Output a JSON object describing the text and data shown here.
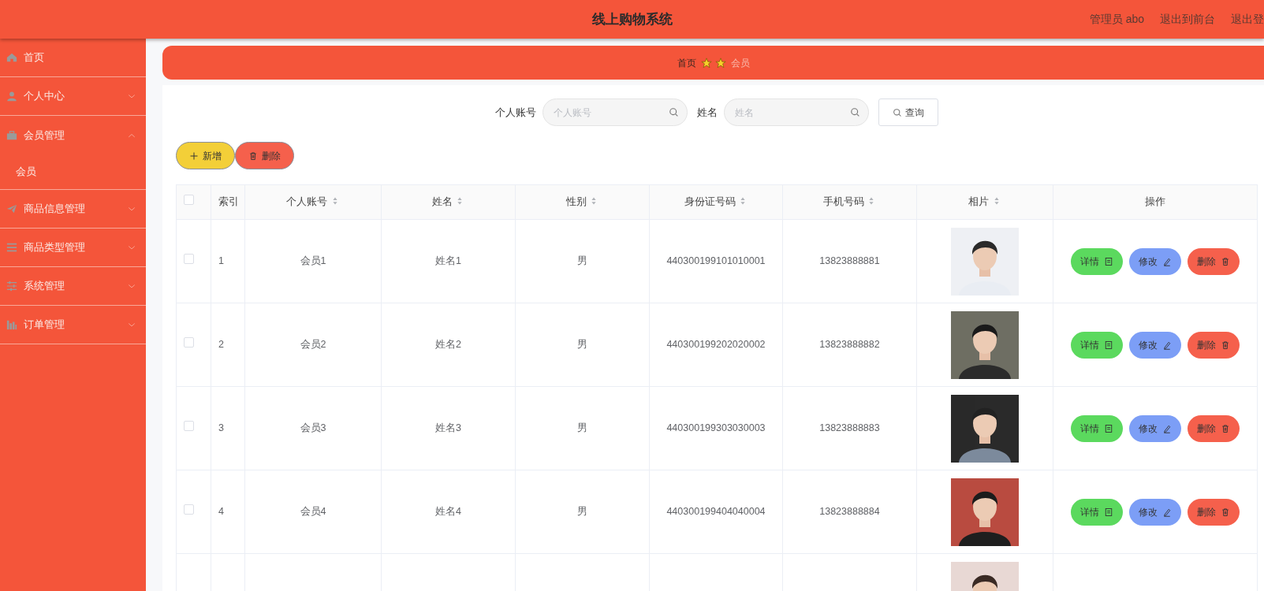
{
  "header": {
    "title": "线上购物系统",
    "links": [
      "管理员 abo",
      "退出到前台",
      "退出登"
    ]
  },
  "sidebar": {
    "items": [
      {
        "label": "首页"
      },
      {
        "label": "个人中心",
        "expanded": false
      },
      {
        "label": "会员管理",
        "expanded": true,
        "children": [
          {
            "label": "会员",
            "selected": false
          }
        ]
      },
      {
        "label": "商品信息管理",
        "expanded": false
      },
      {
        "label": "商品类型管理",
        "expanded": false
      },
      {
        "label": "系统管理",
        "expanded": false
      },
      {
        "label": "订单管理",
        "expanded": false
      }
    ]
  },
  "breadcrumb": [
    "首页",
    "会员"
  ],
  "search": {
    "fields": [
      {
        "label": "个人账号",
        "placeholder": "个人账号"
      },
      {
        "label": "姓名",
        "placeholder": "姓名"
      }
    ],
    "button": "查询"
  },
  "toolbar": [
    {
      "kind": "add",
      "label": "新增"
    },
    {
      "kind": "delete",
      "label": "删除"
    }
  ],
  "table": {
    "select_all": {
      "checked": false
    },
    "columns": [
      {
        "label": "索引",
        "sortable": false
      },
      {
        "label": "个人账号",
        "sortable": true
      },
      {
        "label": "姓名",
        "sortable": true
      },
      {
        "label": "性别",
        "sortable": true
      },
      {
        "label": "身份证号码",
        "sortable": true
      },
      {
        "label": "手机号码",
        "sortable": true
      },
      {
        "label": "相片",
        "sortable": true
      },
      {
        "label": "操作",
        "sortable": false
      }
    ],
    "rows": [
      {
        "checked": false,
        "cells": [
          "1",
          "会员1",
          "姓名1",
          "男",
          "440300199101010001",
          "13823888881"
        ],
        "photo": {
          "kind": "picture"
        },
        "actions": [
          "详情",
          "修改",
          "删除"
        ]
      },
      {
        "checked": false,
        "cells": [
          "2",
          "会员2",
          "姓名2",
          "男",
          "440300199202020002",
          "13823888882"
        ],
        "photo": {
          "kind": "picture"
        },
        "actions": [
          "详情",
          "修改",
          "删除"
        ]
      },
      {
        "checked": false,
        "cells": [
          "3",
          "会员3",
          "姓名3",
          "男",
          "440300199303030003",
          "13823888883"
        ],
        "photo": {
          "kind": "picture"
        },
        "actions": [
          "详情",
          "修改",
          "删除"
        ]
      },
      {
        "checked": false,
        "cells": [
          "4",
          "会员4",
          "姓名4",
          "男",
          "440300199404040004",
          "13823888884"
        ],
        "photo": {
          "kind": "picture"
        },
        "actions": [
          "详情",
          "修改",
          "删除"
        ]
      },
      {
        "photo": {
          "kind": "picture"
        }
      }
    ]
  }
}
